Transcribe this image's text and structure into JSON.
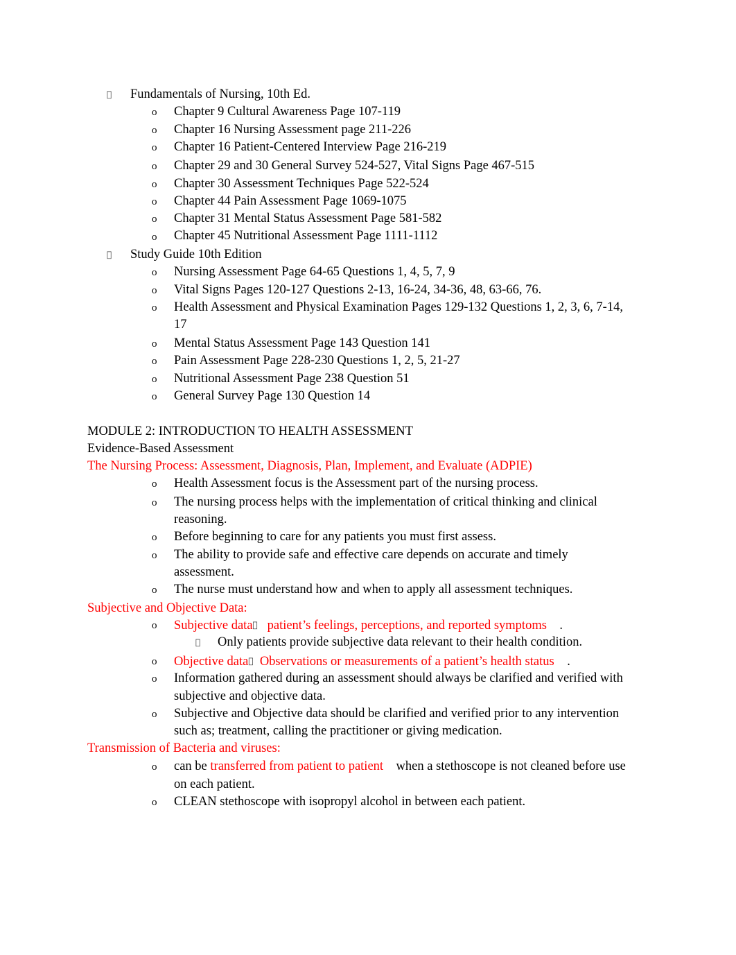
{
  "colors": {
    "text": "#000000",
    "highlight": "#ff0000"
  },
  "bullets": {
    "level1": "",
    "level2": "o",
    "level3": "",
    "arrow": ""
  },
  "section1": {
    "title": "Fundamentals of Nursing,  10th Ed.",
    "items": [
      "Chapter 9 Cultural Awareness Page 107-119",
      "Chapter 16 Nursing Assessment page 211-226",
      "Chapter 16 Patient-Centered Interview Page 216-219",
      "Chapter 29 and 30 General Survey 524-527, Vital Signs Page 467-515",
      "Chapter 30 Assessment Techniques Page 522-524",
      "Chapter 44 Pain Assessment Page 1069-1075",
      "Chapter 31 Mental Status Assessment Page 581-582",
      "Chapter 45 Nutritional Assessment Page 1111-1112"
    ]
  },
  "section2": {
    "title": "Study Guide 10th Edition",
    "items": [
      "Nursing Assessment Page 64-65 Questions 1, 4, 5, 7, 9",
      "Vital Signs Pages 120-127 Questions 2-13, 16-24, 34-36, 48, 63-66, 76.",
      "Health Assessment and Physical Examination Pages 129-132 Questions 1, 2, 3, 6, 7-14,",
      "17",
      "Mental Status Assessment Page 143 Question 141",
      "Pain Assessment Page 228-230 Questions 1, 2, 5, 21-27",
      "Nutritional Assessment Page 238 Question 51",
      "General Survey Page 130 Question 14"
    ]
  },
  "module": {
    "title": "MODULE 2: INTRODUCTION TO HEALTH ASSESSMENT",
    "subtitle": "Evidence-Based Assessment",
    "nursing_process": {
      "heading": "The Nursing Process: Assessment, Diagnosis, Plan, Implement, and Evaluate (ADPIE)",
      "items": [
        "Health Assessment focus is the Assessment part of the nursing process.",
        "The nursing process helps with the implementation of critical thinking and clinical",
        "reasoning.",
        "Before beginning to care for any patients you must first assess.",
        "The ability to provide safe and effective care depends on accurate and timely",
        "assessment.",
        "The nurse must understand how and when to apply all assessment techniques."
      ]
    },
    "data_types": {
      "heading": "Subjective and Objective Data:",
      "subjective_label": "Subjective data",
      "subjective_def": "patient’s feelings, perceptions, and reported symptoms",
      "subjective_note": "Only patients provide subjective data relevant to their health condition.",
      "objective_label": "Objective data",
      "objective_def": "Observations or measurements of a patient’s health status",
      "period": ".",
      "items": [
        "Information gathered during an assessment should always be clarified and verified with",
        "subjective and objective data.",
        "Subjective and Objective data should be clarified and verified prior to any intervention",
        "such as; treatment, calling the practitioner or giving medication."
      ]
    },
    "transmission": {
      "heading": "Transmission of Bacteria and viruses:",
      "item1_prefix": "can be ",
      "item1_highlight": "transferred from patient to patient",
      "item1_suffix": "when a stethoscope is not cleaned before use",
      "item1_cont": "on each patient.",
      "item2": "CLEAN stethoscope with isopropyl alcohol in between each patient."
    }
  }
}
